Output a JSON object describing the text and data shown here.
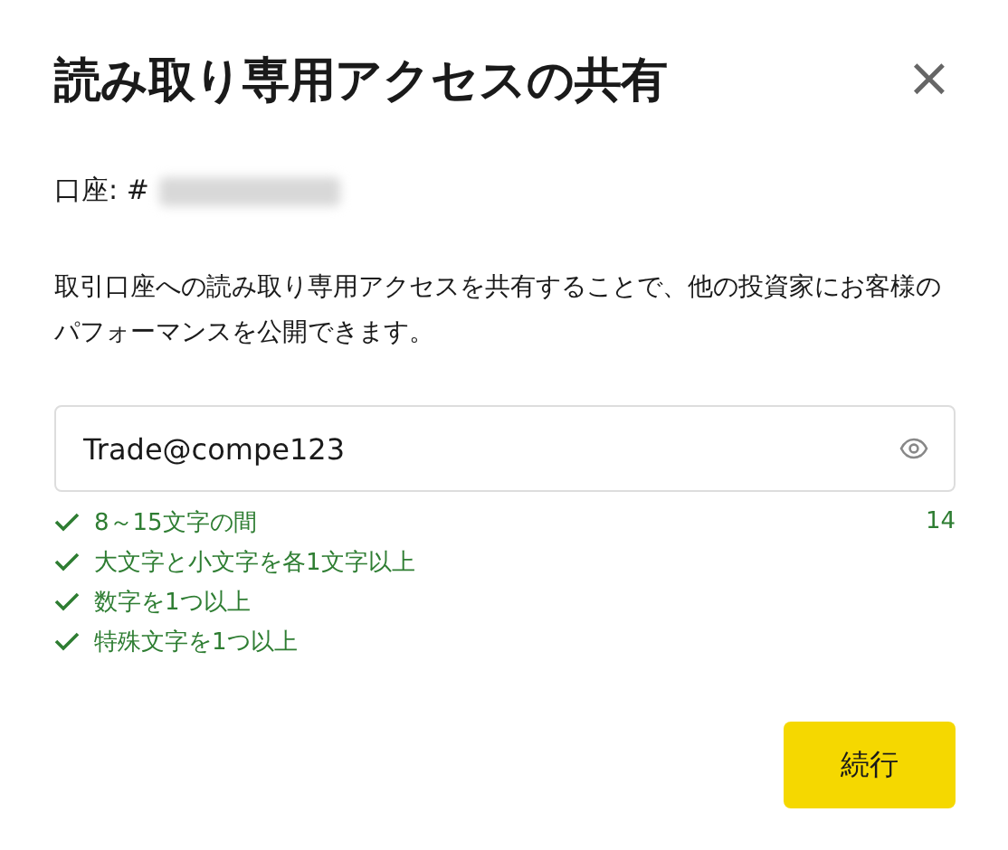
{
  "dialog": {
    "title": "読み取り専用アクセスの共有",
    "close": "×"
  },
  "account": {
    "label": "口座: #",
    "number_hidden": true
  },
  "description": "取引口座への読み取り専用アクセスを共有することで、他の投資家にお客様のパフォーマンスを公開できます。",
  "password": {
    "value": "Trade@compe123",
    "count": "14"
  },
  "rules": [
    {
      "text": "8～15文字の間",
      "met": true
    },
    {
      "text": "大文字と小文字を各1文字以上",
      "met": true
    },
    {
      "text": "数字を1つ以上",
      "met": true
    },
    {
      "text": "特殊文字を1つ以上",
      "met": true
    }
  ],
  "buttons": [
    {
      "label": "続行"
    }
  ]
}
